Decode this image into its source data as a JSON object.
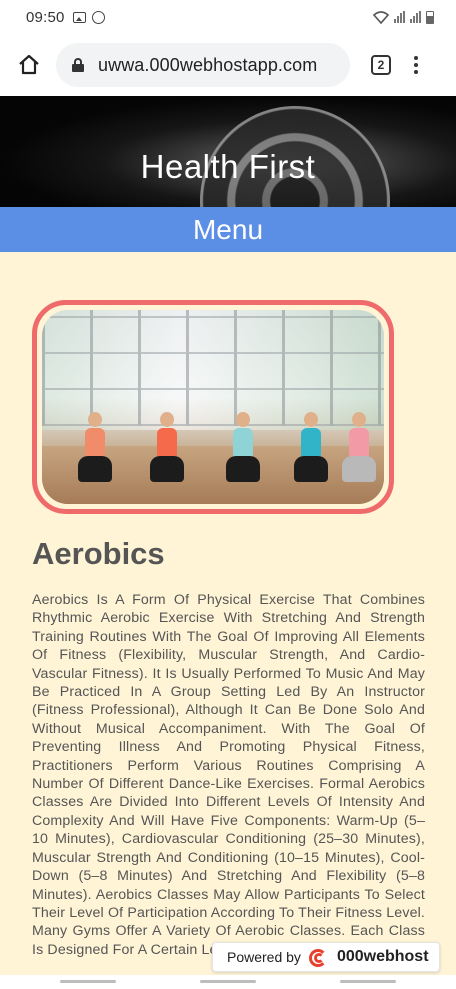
{
  "status_bar": {
    "time": "09:50",
    "icons_left": [
      "image-icon",
      "whatsapp-icon"
    ],
    "icons_right": [
      "wifi-icon",
      "signal-icon",
      "signal-icon",
      "battery-icon"
    ]
  },
  "browser": {
    "url": "uwwa.000webhostapp.com",
    "tab_count": "2"
  },
  "site": {
    "title": "Health  First",
    "menu_label": "Menu"
  },
  "article": {
    "image_alt_icon": "aerobics-photo",
    "title": "Aerobics",
    "body": "Aerobics Is A Form Of Physical Exercise That Combines Rhythmic Aerobic Exercise With Stretching And Strength Training Routines With The Goal Of Improving All Elements Of Fitness (Flexibility, Muscular Strength, And Cardio-Vascular Fitness). It Is Usually Performed To Music And May Be Practiced In A Group Setting Led By An Instructor (Fitness Professional), Although It Can Be Done Solo And Without Musical Accompaniment. With The Goal Of Preventing Illness And Promoting Physical Fitness, Practitioners Perform Various Routines Comprising A Number Of Different Dance-Like Exercises. Formal Aerobics Classes Are Divided Into Different Levels Of Intensity And Complexity And Will Have Five Components: Warm-Up (5–10 Minutes), Cardiovascular Conditioning (25–30 Minutes), Muscular Strength And Conditioning (10–15 Minutes), Cool-Down (5–8 Minutes) And Stretching And Flexibility (5–8 Minutes). Aerobics Classes May Allow Participants To Select Their Level Of Participation According To Their Fitness Level. Many Gyms Offer A Variety Of Aerobic Classes. Each Class Is Designed For A Certain Level Of Experience And Taught"
  },
  "badge": {
    "prefix": "Powered by",
    "brand": "000webhost"
  },
  "colors": {
    "menu_bar": "#5b8fe6",
    "content_bg": "#fff4d6",
    "frame_border": "#ef6a6a"
  }
}
